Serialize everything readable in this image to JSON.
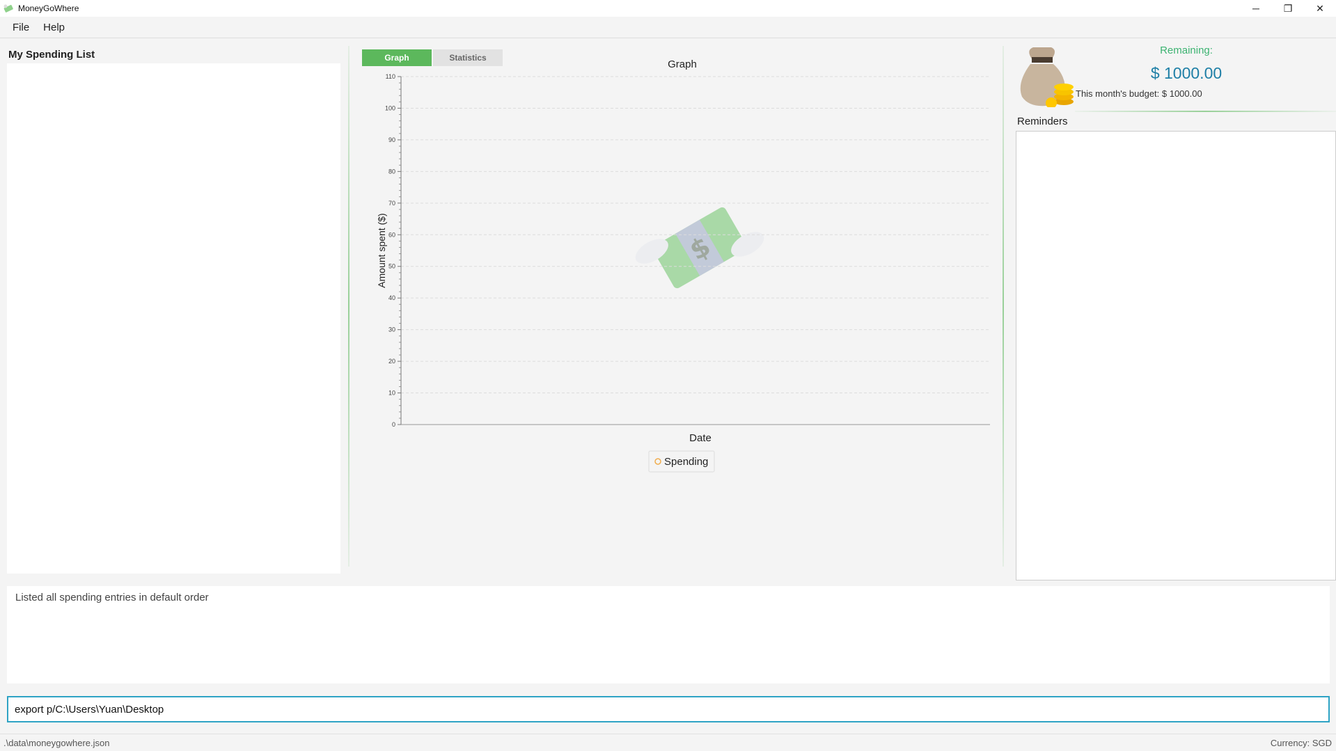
{
  "window": {
    "title": "MoneyGoWhere",
    "controls": {
      "minimize": "─",
      "restore": "❐",
      "close": "✕"
    }
  },
  "menu": {
    "items": [
      "File",
      "Help"
    ]
  },
  "spending_list": {
    "title": "My Spending List"
  },
  "tabs": [
    {
      "label": "Graph",
      "active": true
    },
    {
      "label": "Statistics",
      "active": false
    }
  ],
  "chart_data": {
    "type": "line",
    "title": "Graph",
    "xlabel": "Date",
    "ylabel": "Amount spent ($)",
    "ylim": [
      0,
      110
    ],
    "yticks": [
      0,
      10,
      20,
      30,
      40,
      50,
      60,
      70,
      80,
      90,
      100,
      110
    ],
    "series": [
      {
        "name": "Spending",
        "values": []
      }
    ],
    "grid": true,
    "legend": "bottom-center"
  },
  "budget": {
    "remaining_label": "Remaining:",
    "remaining_amount": "$ 1000.00",
    "monthly_budget": "This month's budget: $ 1000.00"
  },
  "reminders": {
    "title": "Reminders"
  },
  "result_display": {
    "text": "Listed all spending entries in default order"
  },
  "command_box": {
    "value": "export p/C:\\Users\\Yuan\\Desktop"
  },
  "status_bar": {
    "file_path": ".\\data\\moneygowhere.json",
    "currency": "Currency: SGD"
  },
  "colors": {
    "accent_green": "#5cb85c",
    "remaining_green": "#3cb371",
    "amount_blue": "#1e7fa6",
    "command_border": "#2ea3c4"
  }
}
